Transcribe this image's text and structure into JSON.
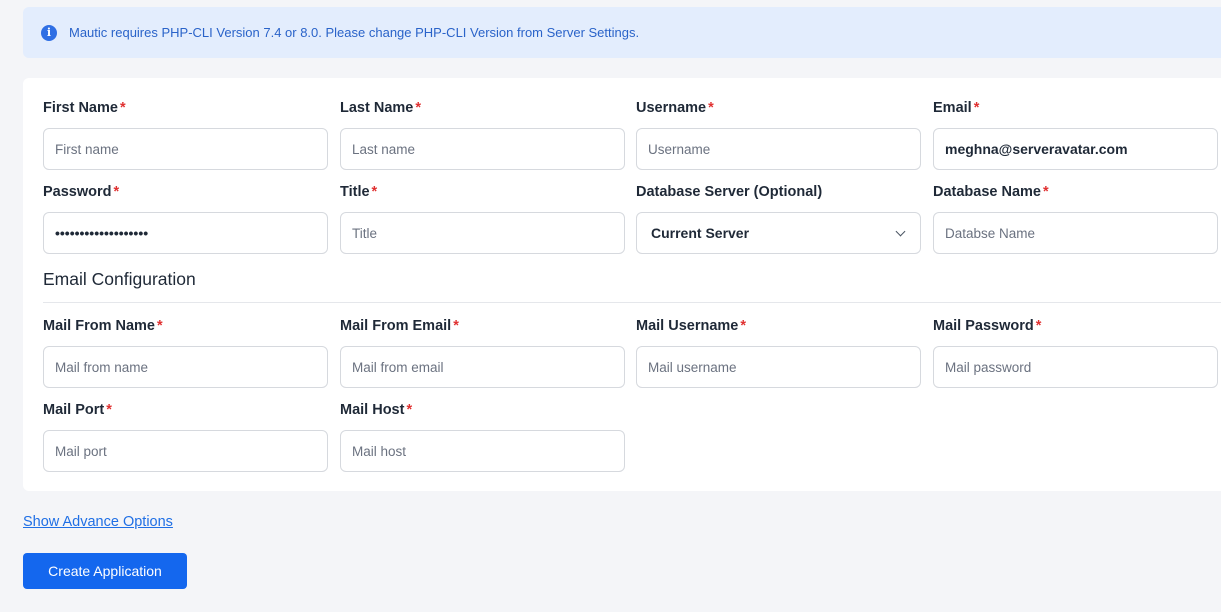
{
  "alert": {
    "icon": "info-icon",
    "text": "Mautic requires PHP-CLI Version 7.4 or 8.0. Please change PHP-CLI Version from Server Settings."
  },
  "form": {
    "fields": [
      {
        "label": "First Name",
        "required": "*",
        "placeholder": "First name",
        "value": ""
      },
      {
        "label": "Last Name",
        "required": "*",
        "placeholder": "Last name",
        "value": ""
      },
      {
        "label": "Username",
        "required": "*",
        "placeholder": "Username",
        "value": ""
      },
      {
        "label": "Email",
        "required": "*",
        "placeholder": "",
        "value": "meghna@serveravatar.com"
      },
      {
        "label": "Password",
        "required": "*",
        "placeholder": "",
        "value": "meghna@serveravatar"
      },
      {
        "label": "Title",
        "required": "*",
        "placeholder": "Title",
        "value": ""
      },
      {
        "label": "Database Server (Optional)",
        "selected": "Current Server"
      },
      {
        "label": "Database Name",
        "required": "*",
        "placeholder": "Databse Name",
        "value": ""
      }
    ],
    "email_section_title": "Email Configuration",
    "mail_fields": [
      {
        "label": "Mail From Name",
        "required": "*",
        "placeholder": "Mail from name"
      },
      {
        "label": "Mail From Email",
        "required": "*",
        "placeholder": "Mail from email"
      },
      {
        "label": "Mail Username",
        "required": "*",
        "placeholder": "Mail username"
      },
      {
        "label": "Mail Password",
        "required": "*",
        "placeholder": "Mail password"
      },
      {
        "label": "Mail Port",
        "required": "*",
        "placeholder": "Mail port"
      },
      {
        "label": "Mail Host",
        "required": "*",
        "placeholder": "Mail host"
      }
    ]
  },
  "advance_link": "Show Advance Options",
  "create_button": "Create Application",
  "colors": {
    "accent": "#1467ee",
    "alert_bg": "#e3edfd",
    "required": "#e03131"
  }
}
